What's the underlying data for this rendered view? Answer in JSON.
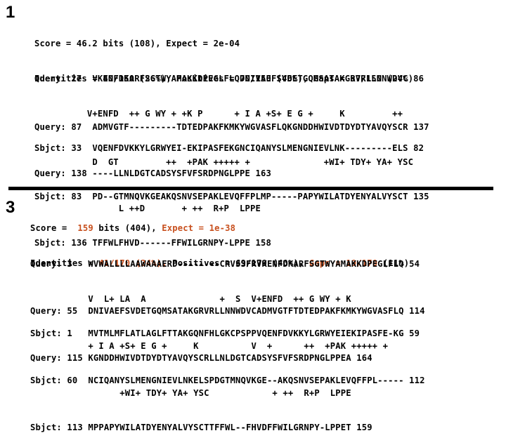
{
  "hits": [
    {
      "number": "1",
      "summary": {
        "score_label": "Score =",
        "score_bits": "46.2",
        "bits_raw": "bits (108),",
        "expect_label": "Expect =",
        "expect_value": "2e-04",
        "identities_label": "Identities =",
        "identities_value": "40/150 (26%),",
        "positives_label": "Positives =",
        "positives_value": "70/150 (46%),",
        "gaps_label": "Gaps =",
        "gaps_value": "37/150 (24%)"
      },
      "alignments": [
        {
          "query_label": "Query: 27 ",
          "query_seq": "VKENFDKARFSGTWYAMAKKDPEGLFLQDNIVAEFSVDETGQMSATAKGRVRLLNNWDVC 86",
          "match_seq": "          V+ENFD  ++ G WY + +K P      + I A +S+ E G +     K         ++",
          "sbjct_label": "Sbjct: 33 ",
          "sbjct_seq": "VQENFDVKKYLGRWYEI-EKIPASFEKGNCIQANYSLMENGNIEVLNK---------ELS 82"
        },
        {
          "query_label": "Query: 87 ",
          "query_seq": "ADMVGTF---------TDTEDPAKFKMKYWGVASFLQKGNDDHWIVDTDYDTYAVQYSCR 137",
          "match_seq": "           D  GT         ++  +PAK +++++ +              +WI+ TDY+ YA+ YSC",
          "sbjct_label": "Sbjct: 83 ",
          "sbjct_seq": "PD--GTMNQVKGEAKQSNVSEPAKLEVQFFPLMP-----PAPYWILATDYENYALVYSCT 135"
        },
        {
          "query_label": "Query: 138",
          "query_seq": "----LLNLDGTCADSYSFVFSRDPNGLPPE 163",
          "match_seq": "                L ++D       + ++  R+P  LPPE",
          "sbjct_label": "Sbjct: 136",
          "sbjct_seq": "TFFWLFHVD------FFWILGRNPY-LPPE 158"
        }
      ]
    },
    {
      "number": "3",
      "summary": {
        "score_label": "Score =",
        "score_bits": "159",
        "bits_raw": "bits (404),",
        "expect_label": "Expect =",
        "expect_value": "1e-38",
        "identities_label": "Identities =",
        "identities_value": "41/170 (24%),",
        "positives_label": "Positives =",
        "positives_value": "69/170 (40%),",
        "gaps_label": "Gaps =",
        "gaps_value": "19/170",
        "gaps_pct": "(11%)"
      },
      "highlight_color": "#c8501e",
      "alignments": [
        {
          "query_label": "Query: 3  ",
          "query_seq": "WVWALLLLAAWAAAERD--------CRVSSFRVKENFDKARFSGTWYAMAKKDPEGLFLQ 54",
          "match_seq": "           V  L+ LA  A              +  S  V+ENFD  ++ G WY + K",
          "sbjct_label": "Sbjct: 1  ",
          "sbjct_seq": "MVTMLMFLATLAGLFTTAKGQNFHLGKCPSPPVQENFDVKKYLGRWYEIEKIPASFE-KG 59"
        },
        {
          "query_label": "Query: 55 ",
          "query_seq": "DNIVAEFSVDETGQMSATAKGRVRLLNNWDVCADMVGTFTDTEDPAKFKMKYWGVASFLQ 114",
          "match_seq": "           + I A +S+ E G +     K          V  +      ++  +PAK +++++ +",
          "sbjct_label": "Sbjct: 60 ",
          "sbjct_seq": "NCIQANYSLMENGNIEVLNKELSPDGTMNQVKGE--AKQSNVSEPAKLEVQFFPL----- 112"
        },
        {
          "query_label": "Query: 115",
          "query_seq": "KGNDDHWIVDTDYDTYAVQYSCRLLNLDGTCADSYSFVFSRDPNGLPPEA 164",
          "match_seq": "                 +WI+ TDY+ YA+ YSC            + ++  R+P  LPPE",
          "sbjct_label": "Sbjct: 113",
          "sbjct_seq": "MPPAPYWILATDYENYALVYSCTTFFWL--FHVDFFWILGRNPY-LPPET 159"
        }
      ]
    }
  ]
}
